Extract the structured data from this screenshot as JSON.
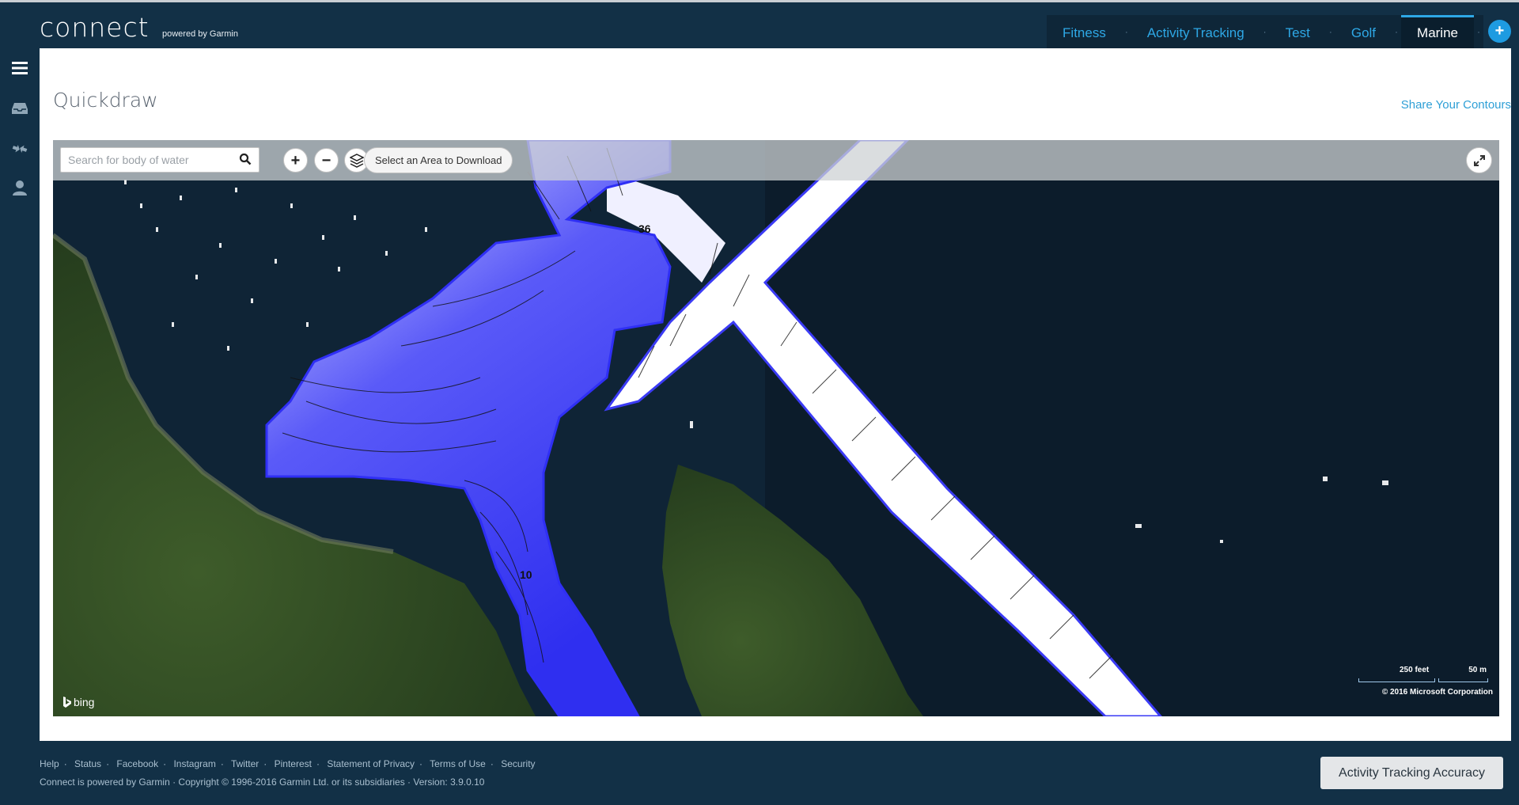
{
  "app": {
    "logo_text": "connect",
    "logo_sub": "powered by Garmin"
  },
  "tabs": [
    {
      "label": "Fitness",
      "active": false
    },
    {
      "label": "Activity Tracking",
      "active": false
    },
    {
      "label": "Test",
      "active": false
    },
    {
      "label": "Golf",
      "active": false
    },
    {
      "label": "Marine",
      "active": true
    }
  ],
  "tab_separator": "·",
  "add_tab_label": "+",
  "leftnav": [
    "menu-icon",
    "inbox-icon",
    "connections-icon",
    "profile-icon"
  ],
  "page": {
    "title": "Quickdraw",
    "share_link": "Share Your Contours"
  },
  "map": {
    "search_placeholder": "Search for body of water",
    "zoom_in": "+",
    "zoom_out": "−",
    "select_area_label": "Select an Area to Download",
    "depth_labels": [
      "36",
      "10"
    ],
    "attribution_logo": "bing",
    "scale_feet": "250 feet",
    "scale_meters": "50 m",
    "copyright": "© 2016 Microsoft Corporation"
  },
  "footer": {
    "links": [
      "Help",
      "Status",
      "Facebook",
      "Instagram",
      "Twitter",
      "Pinterest",
      "Statement of Privacy",
      "Terms of Use",
      "Security"
    ],
    "copyright": "Connect is powered by Garmin · Copyright © 1996-2016 Garmin Ltd. or its subsidiaries · Version: 3.9.0.10",
    "accuracy_button": "Activity Tracking Accuracy"
  },
  "colors": {
    "header_bg": "#123046",
    "accent": "#2ea8e6",
    "contour_blue": "#3a3af0",
    "water": "#0f2233"
  }
}
